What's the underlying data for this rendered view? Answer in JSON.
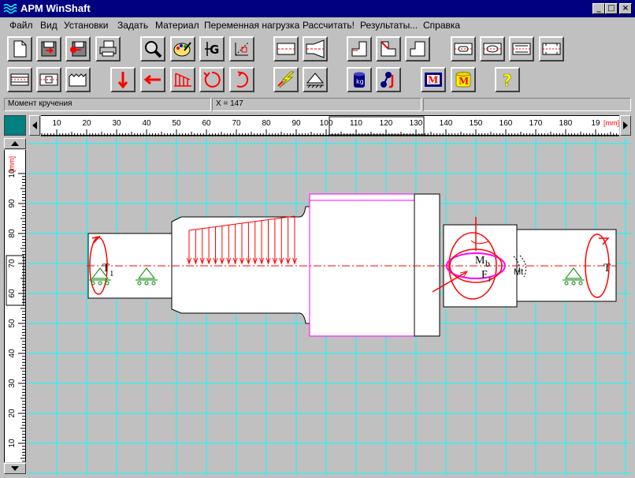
{
  "window": {
    "title": "APM WinShaft",
    "buttons": {
      "minimize": "_",
      "maximize": "□",
      "close": "×"
    }
  },
  "menu": [
    "Файл",
    "Вид",
    "Установки",
    "Задать",
    "Материал",
    "Переменная нагрузка",
    "Рассчитать!",
    "Результаты...",
    "Справка"
  ],
  "toolbar": {
    "row1": [
      "new-file",
      "save-red",
      "save-as",
      "print",
      "zoom",
      "palette",
      "text-g",
      "dimension",
      "section-shaft",
      "section-cone",
      "step-left",
      "step-inner",
      "step-right",
      "groove-1",
      "groove-2",
      "groove-3",
      "groove-4"
    ],
    "row2": [
      "gear-1",
      "gear-2",
      "gear-3",
      "force-down",
      "force-left",
      "distributed-load",
      "moment-ccw",
      "moment-cw",
      "lightning-load",
      "support-fixed",
      "material-cylinder",
      "bearing-joint",
      "results-m",
      "results-m-cylinder",
      "help"
    ]
  },
  "status": {
    "mode": "Момент кручения",
    "x_readout": "X = 147",
    "extra": ""
  },
  "ruler": {
    "h_ticks": [
      "10",
      "20",
      "30",
      "40",
      "50",
      "60",
      "70",
      "80",
      "90",
      "100",
      "110",
      "120",
      "130",
      "140",
      "150",
      "160",
      "170",
      "180",
      "19"
    ],
    "h_unit": "[mm]",
    "v_ticks": [
      "10",
      "90",
      "80",
      "70",
      "60",
      "50",
      "40",
      "30",
      "20",
      "10"
    ],
    "v_unit": "[mm]"
  },
  "drawing": {
    "labels": {
      "torque_left": "T",
      "torque_left_sub": "1",
      "torque_right": "T",
      "bending_moment": "M",
      "bending_moment_sub": "b",
      "force": "F",
      "force_sub": "r",
      "twisting_moment": "Mt"
    }
  },
  "colors": {
    "title_bar": "#000080",
    "workspace": "#c0c0c0",
    "grid": "#00ffff",
    "load": "#ff0000",
    "selection": "#ff00ff",
    "support": "#008000"
  }
}
